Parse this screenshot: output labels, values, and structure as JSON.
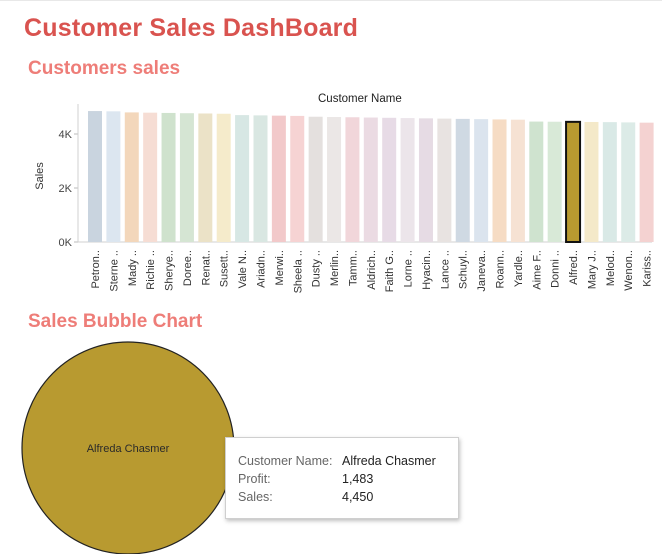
{
  "dashboard": {
    "title": "Customer Sales DashBoard"
  },
  "sections": {
    "bars_title": "Customers sales",
    "bubble_title": "Sales Bubble Chart"
  },
  "chart_data": [
    {
      "type": "bar",
      "title": "",
      "column_header": "Customer Name",
      "ylabel": "Sales",
      "yticks": [
        "0K",
        "2K",
        "4K"
      ],
      "ylim": [
        0,
        5000
      ],
      "categories": [
        "Petron..",
        "Sterne ..",
        "Mady ..",
        "Richie ..",
        "Sherye..",
        "Doree..",
        "Renat..",
        "Susett..",
        "Vale N..",
        "Ariadn..",
        "Merwi..",
        "Sheela ..",
        "Dusty ..",
        "Merlin..",
        "Tamm..",
        "Aldrich..",
        "Faith G..",
        "Lorne ..",
        "Hyacin..",
        "Lance ..",
        "Schuyl..",
        "Janeva..",
        "Roann..",
        "Yardle..",
        "Aime F..",
        "Donni ..",
        "Alfred..",
        "Mary J..",
        "Melod..",
        "Wenon..",
        "Kariss.."
      ],
      "values": [
        4850,
        4840,
        4800,
        4790,
        4780,
        4770,
        4760,
        4750,
        4700,
        4690,
        4680,
        4670,
        4640,
        4630,
        4620,
        4610,
        4600,
        4590,
        4580,
        4570,
        4560,
        4550,
        4540,
        4530,
        4460,
        4455,
        4450,
        4445,
        4440,
        4430,
        4420
      ],
      "highlighted": "Alfred..",
      "colors": [
        "#c9d4df",
        "#dce6f0",
        "#f3d7bb",
        "#f6ddd4",
        "#cfe2cd",
        "#d5e5d3",
        "#ebe2c7",
        "#f5ebcb",
        "#d7e7e4",
        "#d9e7e2",
        "#f2c9ca",
        "#f6d3d3",
        "#e4e0de",
        "#ebe7e6",
        "#f1d6da",
        "#ebdbe3",
        "#e7dbe6",
        "#ece5ea",
        "#e6dbe4",
        "#e8e3e1",
        "#cfd9e3",
        "#dbe4ee",
        "#f6dcc4",
        "#f6e2d3",
        "#cfe3cf",
        "#d8e9d7",
        "#b89a30",
        "#f4e9c9",
        "#d9e9e6",
        "#dcebe7",
        "#f4d2d1"
      ],
      "highlight_color": "#b89a30"
    },
    {
      "type": "bubble",
      "title": "",
      "bubbles": [
        {
          "label": "Alfreda Chasmer",
          "sales": 4450,
          "profit": 1483,
          "color": "#b89a30"
        }
      ]
    }
  ],
  "tooltip": {
    "rows": [
      {
        "label": "Customer Name:",
        "value": "Alfreda Chasmer"
      },
      {
        "label": "Profit:",
        "value": "1,483"
      },
      {
        "label": "Sales:",
        "value": "4,450"
      }
    ]
  }
}
